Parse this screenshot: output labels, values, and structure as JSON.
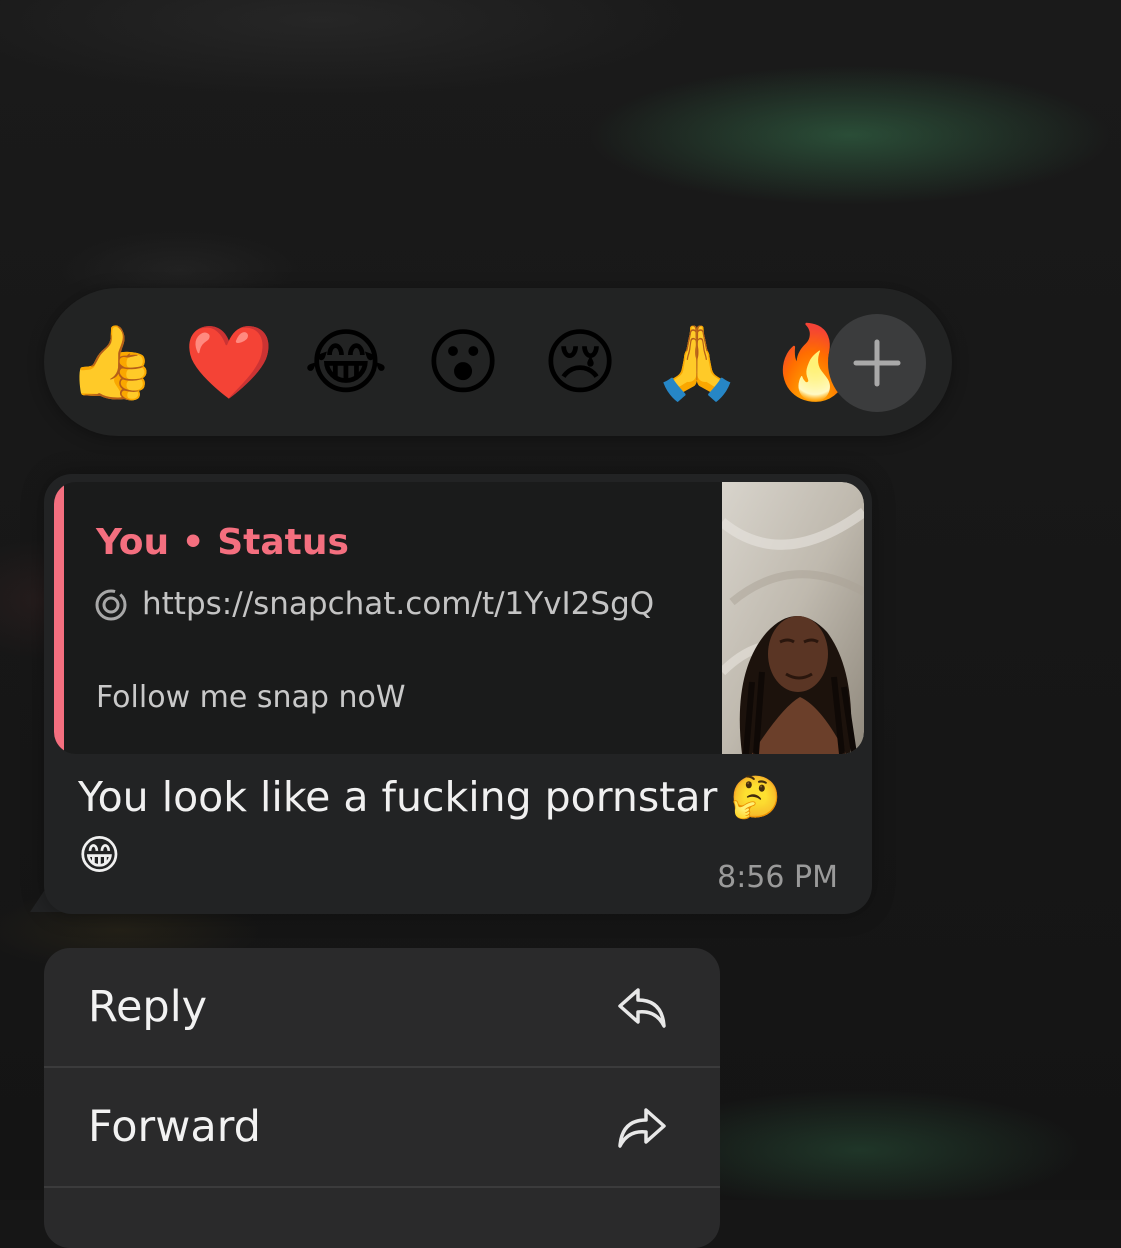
{
  "reactions": {
    "items": [
      {
        "emoji": "👍",
        "name": "thumbs-up"
      },
      {
        "emoji": "❤️",
        "name": "red-heart"
      },
      {
        "emoji": "😂",
        "name": "tears-of-joy"
      },
      {
        "emoji": "😮",
        "name": "surprised"
      },
      {
        "emoji": "😢",
        "name": "crying"
      },
      {
        "emoji": "🙏",
        "name": "folded-hands"
      },
      {
        "emoji": "🔥",
        "name": "fire"
      }
    ],
    "more_icon": "plus-icon"
  },
  "message": {
    "quote": {
      "author": "You • Status",
      "link_icon": "snapchat-ring-icon",
      "link": "https://snapchat.com/t/1YvI2SgQ",
      "text": "Follow me snap noW"
    },
    "text": "You look like a fucking pornstar 🤔 😁",
    "time": "8:56 PM"
  },
  "menu": {
    "items": [
      {
        "label": "Reply",
        "icon": "reply-arrow-icon"
      },
      {
        "label": "Forward",
        "icon": "forward-arrow-icon"
      }
    ]
  }
}
